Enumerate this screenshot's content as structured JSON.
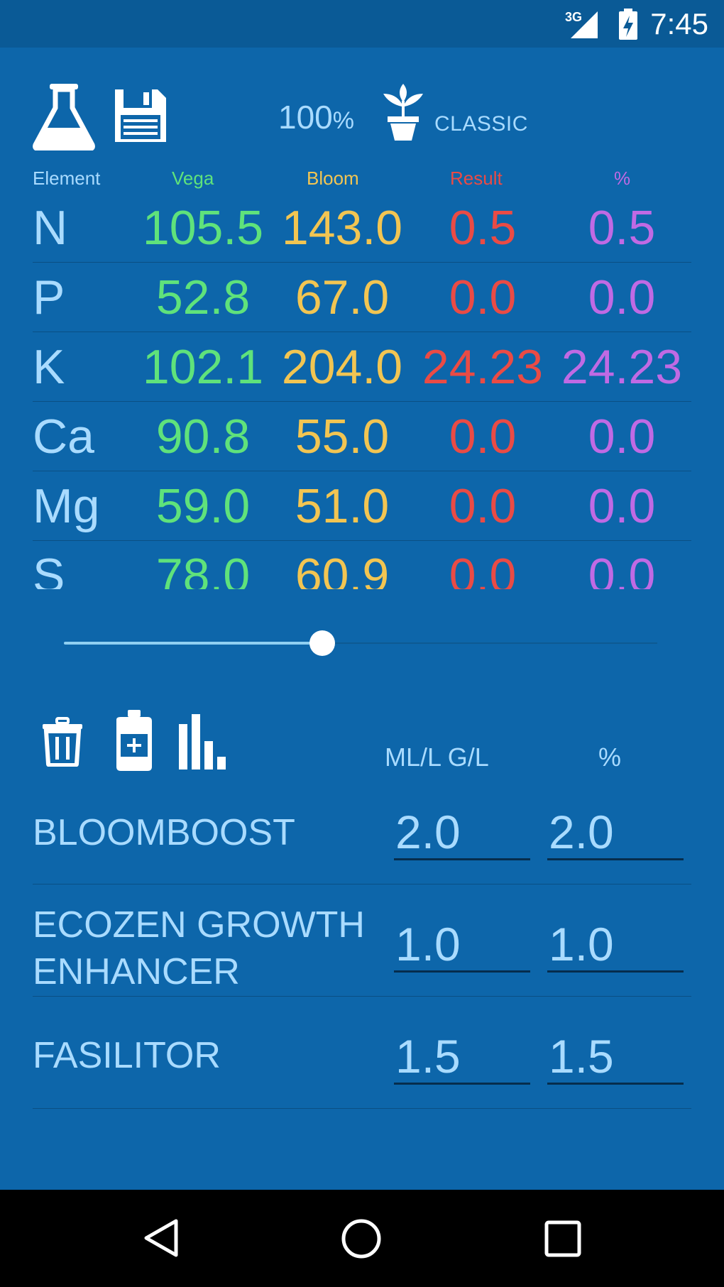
{
  "status_bar": {
    "time": "7:45",
    "network": "3G",
    "signal_icon": "signal-icon",
    "battery_icon": "battery-charging-icon"
  },
  "toolbar": {
    "flask_icon": "flask-icon",
    "save_icon": "floppy-disk-icon",
    "strength_value": "100",
    "strength_unit": "%",
    "plant_icon": "potted-plant-icon",
    "mode": "CLASSIC"
  },
  "columns": {
    "element": "Element",
    "vega": "Vega",
    "bloom": "Bloom",
    "result": "Result",
    "pct": "%"
  },
  "elements": [
    {
      "name": "N",
      "vega": "105.5",
      "bloom": "143.0",
      "result": "0.5",
      "pct": "0.5"
    },
    {
      "name": "P",
      "vega": "52.8",
      "bloom": "67.0",
      "result": "0.0",
      "pct": "0.0"
    },
    {
      "name": "K",
      "vega": "102.1",
      "bloom": "204.0",
      "result": "24.23",
      "pct": "24.23"
    },
    {
      "name": "Ca",
      "vega": "90.8",
      "bloom": "55.0",
      "result": "0.0",
      "pct": "0.0"
    },
    {
      "name": "Mg",
      "vega": "59.0",
      "bloom": "51.0",
      "result": "0.0",
      "pct": "0.0"
    },
    {
      "name": "S",
      "vega": "78.0",
      "bloom": "60.9",
      "result": "0.0",
      "pct": "0.0"
    }
  ],
  "slider": {
    "value_fraction": 0.435
  },
  "products_toolbar": {
    "delete_icon": "trash-icon",
    "add_icon": "add-bottle-icon",
    "chart_icon": "bar-chart-icon",
    "dose_header": "ML/L G/L",
    "pct_header": "%"
  },
  "products": [
    {
      "name": "BLOOMBOOST",
      "dose": "2.0",
      "pct": "2.0"
    },
    {
      "name": "ECOZEN GROWTH ENHANCER",
      "dose": "1.0",
      "pct": "1.0"
    },
    {
      "name": "FASILITOR",
      "dose": "1.5",
      "pct": "1.5"
    }
  ],
  "nav": {
    "back_icon": "back-triangle-icon",
    "home_icon": "home-circle-icon",
    "recents_icon": "recents-square-icon"
  },
  "colors": {
    "background": "#0d66aa",
    "vega": "#5fe27b",
    "bloom": "#f2c552",
    "result": "#ea4b45",
    "pct": "#c06ae4",
    "text": "#a9dbff"
  }
}
